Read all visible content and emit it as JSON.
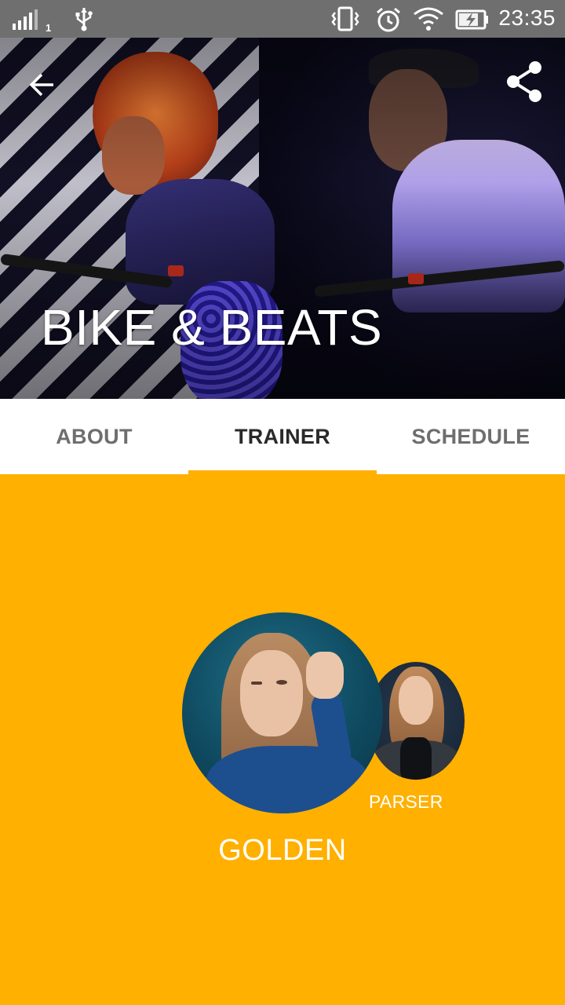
{
  "status_bar": {
    "sim_slot": "1",
    "time": "23:35",
    "icons": [
      "signal-icon",
      "usb-icon",
      "vibrate-icon",
      "alarm-icon",
      "wifi-icon",
      "battery-charging-icon"
    ]
  },
  "header": {
    "title": "BIKE & BEATS",
    "back_icon": "arrow-left-icon",
    "share_icon": "share-icon"
  },
  "tabs": [
    {
      "label": "ABOUT",
      "active": false
    },
    {
      "label": "TRAINER",
      "active": true
    },
    {
      "label": "SCHEDULE",
      "active": false
    }
  ],
  "trainers": {
    "primary": {
      "name": "GOLDEN"
    },
    "secondary": {
      "name": "PARSER"
    }
  },
  "colors": {
    "accent": "#FFB000",
    "status_bar": "#6F6F6F",
    "tab_active_text": "#2A2A2A",
    "tab_inactive_text": "#6E6E6E"
  }
}
